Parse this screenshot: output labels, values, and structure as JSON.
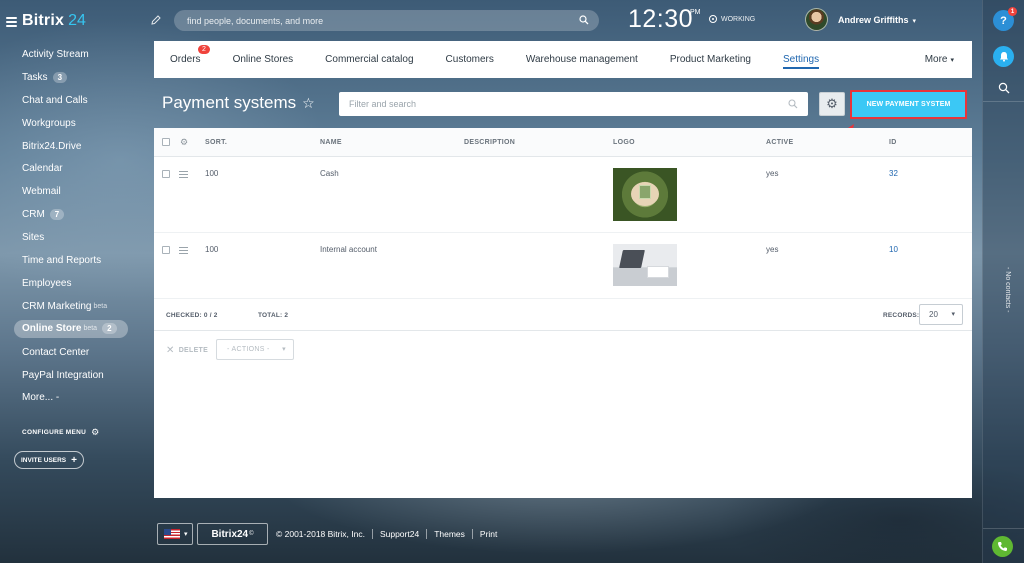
{
  "app": {
    "logo_text": "Bitrix",
    "logo_num": "24"
  },
  "header": {
    "search_placeholder": "find people, documents, and more",
    "time": "12:30",
    "ampm": "PM",
    "status": "WORKING",
    "user_name": "Andrew Griffiths"
  },
  "sidebar": {
    "items": [
      {
        "label": "Activity Stream"
      },
      {
        "label": "Tasks",
        "count": "3"
      },
      {
        "label": "Chat and Calls"
      },
      {
        "label": "Workgroups"
      },
      {
        "label": "Bitrix24.Drive"
      },
      {
        "label": "Calendar"
      },
      {
        "label": "Webmail"
      },
      {
        "label": "CRM",
        "count": "7"
      },
      {
        "label": "Sites"
      },
      {
        "label": "Time and Reports"
      },
      {
        "label": "Employees"
      },
      {
        "label": "CRM Marketing",
        "beta": "beta"
      },
      {
        "label": "Online Store",
        "beta": "beta",
        "count": "2"
      },
      {
        "label": "Contact Center"
      },
      {
        "label": "PayPal Integration"
      },
      {
        "label": "More... -"
      }
    ],
    "configure_label": "CONFIGURE MENU",
    "invite_label": "INVITE USERS"
  },
  "tabs": [
    {
      "label": "Orders",
      "badge": "2"
    },
    {
      "label": "Online Stores"
    },
    {
      "label": "Commercial catalog"
    },
    {
      "label": "Customers"
    },
    {
      "label": "Warehouse management"
    },
    {
      "label": "Product Marketing"
    },
    {
      "label": "Settings"
    }
  ],
  "more_tab": "More",
  "page": {
    "title": "Payment systems",
    "filter_placeholder": "Filter and search",
    "new_button": "NEW PAYMENT SYSTEM"
  },
  "grid": {
    "headers": {
      "sort": "SORT.",
      "name": "NAME",
      "description": "DESCRIPTION",
      "logo": "LOGO",
      "active": "ACTIVE",
      "id": "ID"
    },
    "rows": [
      {
        "sort": "100",
        "name": "Cash",
        "description": "",
        "active": "yes",
        "id": "32"
      },
      {
        "sort": "100",
        "name": "Internal account",
        "description": "",
        "active": "yes",
        "id": "10"
      }
    ],
    "checked": "CHECKED: 0 / 2",
    "total": "TOTAL: 2",
    "records_label": "RECORDS:",
    "records_value": "20",
    "delete_label": "DELETE",
    "actions_label": "- ACTIONS -"
  },
  "rail": {
    "help_badge": "1",
    "no_contacts": "- No contacts -"
  },
  "footer": {
    "brand": "Bitrix24",
    "brand_mark": "©",
    "links": [
      "© 2001-2018 Bitrix, Inc.",
      "Support24",
      "Themes",
      "Print"
    ]
  }
}
